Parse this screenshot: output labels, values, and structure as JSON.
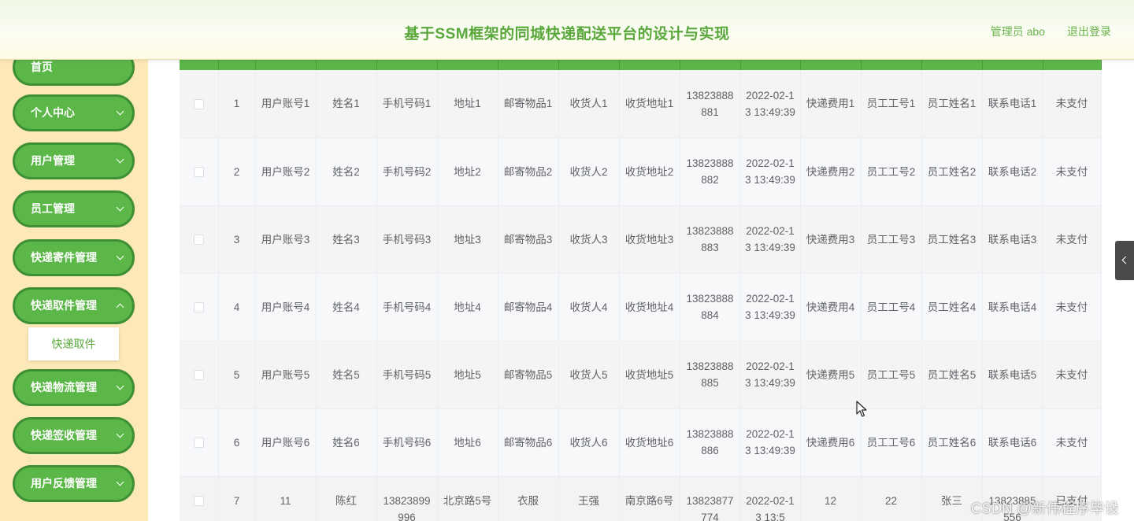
{
  "header": {
    "title": "基于SSM框架的同城快递配送平台的设计与实现",
    "user": "管理员 abo",
    "logout": "退出登录"
  },
  "sidebar": {
    "items": [
      {
        "label": "首页"
      },
      {
        "label": "个人中心"
      },
      {
        "label": "用户管理"
      },
      {
        "label": "员工管理"
      },
      {
        "label": "快递寄件管理"
      },
      {
        "label": "快递取件管理"
      },
      {
        "label": "快递物流管理"
      },
      {
        "label": "快递签收管理"
      },
      {
        "label": "用户反馈管理"
      }
    ],
    "submenu_item": "快递取件"
  },
  "table": {
    "rows": [
      [
        "1",
        "用户账号1",
        "姓名1",
        "手机号码1",
        "地址1",
        "邮寄物品1",
        "收货人1",
        "收货地址1",
        "13823888881",
        "2022-02-13 13:49:39",
        "快递费用1",
        "员工工号1",
        "员工姓名1",
        "联系电话1",
        "未支付"
      ],
      [
        "2",
        "用户账号2",
        "姓名2",
        "手机号码2",
        "地址2",
        "邮寄物品2",
        "收货人2",
        "收货地址2",
        "13823888882",
        "2022-02-13 13:49:39",
        "快递费用2",
        "员工工号2",
        "员工姓名2",
        "联系电话2",
        "未支付"
      ],
      [
        "3",
        "用户账号3",
        "姓名3",
        "手机号码3",
        "地址3",
        "邮寄物品3",
        "收货人3",
        "收货地址3",
        "13823888883",
        "2022-02-13 13:49:39",
        "快递费用3",
        "员工工号3",
        "员工姓名3",
        "联系电话3",
        "未支付"
      ],
      [
        "4",
        "用户账号4",
        "姓名4",
        "手机号码4",
        "地址4",
        "邮寄物品4",
        "收货人4",
        "收货地址4",
        "13823888884",
        "2022-02-13 13:49:39",
        "快递费用4",
        "员工工号4",
        "员工姓名4",
        "联系电话4",
        "未支付"
      ],
      [
        "5",
        "用户账号5",
        "姓名5",
        "手机号码5",
        "地址5",
        "邮寄物品5",
        "收货人5",
        "收货地址5",
        "13823888885",
        "2022-02-13 13:49:39",
        "快递费用5",
        "员工工号5",
        "员工姓名5",
        "联系电话5",
        "未支付"
      ],
      [
        "6",
        "用户账号6",
        "姓名6",
        "手机号码6",
        "地址6",
        "邮寄物品6",
        "收货人6",
        "收货地址6",
        "13823888886",
        "2022-02-13 13:49:39",
        "快递费用6",
        "员工工号6",
        "员工姓名6",
        "联系电话6",
        "未支付"
      ],
      [
        "7",
        "11",
        "陈红",
        "13823899996",
        "北京路5号",
        "衣服",
        "王强",
        "南京路6号",
        "13823877774",
        "2022-02-13 13:5",
        "12",
        "22",
        "张三",
        "13823885556",
        "已支付"
      ]
    ]
  },
  "watermark": "CSDN @新伟程序毕设"
}
